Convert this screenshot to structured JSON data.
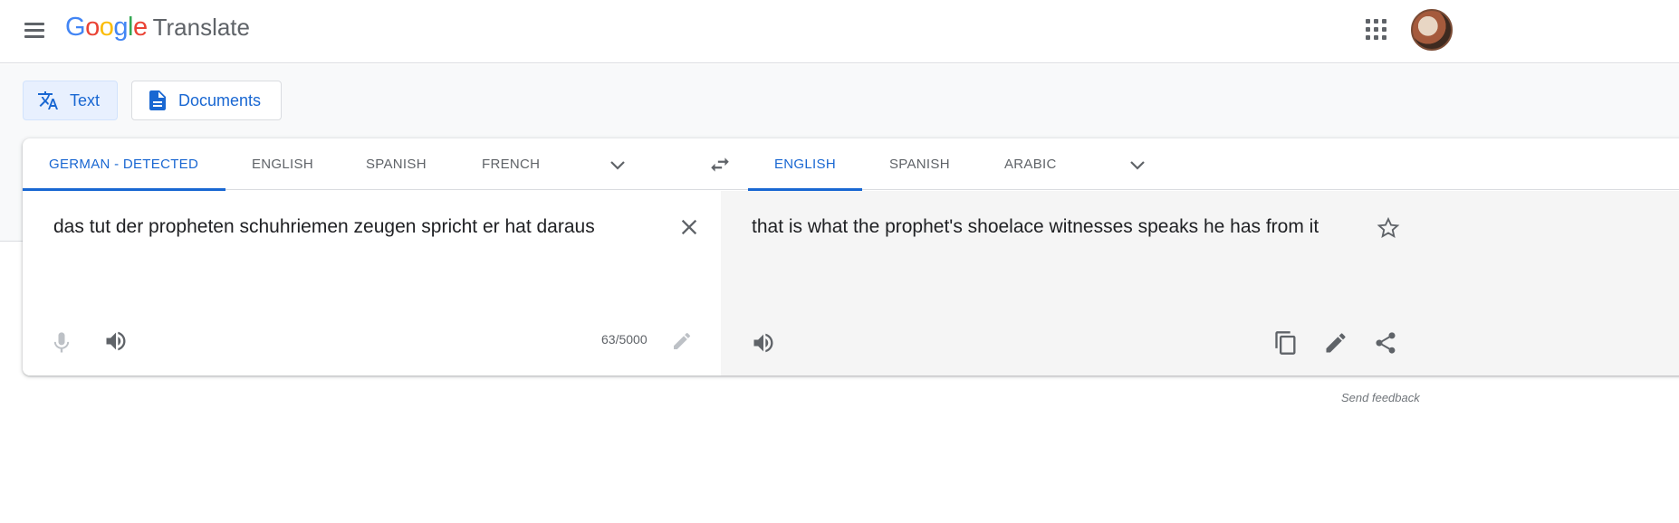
{
  "header": {
    "logo_text": "Google",
    "product_name": "Translate",
    "icons": [
      "menu-icon",
      "apps-grid-icon",
      "avatar"
    ]
  },
  "modes": {
    "text_label": "Text",
    "documents_label": "Documents"
  },
  "source_langs": {
    "tabs": [
      "GERMAN - DETECTED",
      "ENGLISH",
      "SPANISH",
      "FRENCH"
    ],
    "active_index": 0
  },
  "target_langs": {
    "tabs": [
      "ENGLISH",
      "SPANISH",
      "ARABIC"
    ],
    "active_index": 0
  },
  "source": {
    "text": "das tut der propheten schuhriemen zeugen spricht er hat daraus",
    "char_count": "63/5000"
  },
  "target": {
    "text": "that is what the prophet's shoelace witnesses speaks he has from it"
  },
  "footer": {
    "feedback": "Send feedback"
  },
  "colors": {
    "accent": "#1967d2",
    "active_bg": "#e8f0fe",
    "icon_gray": "#5f6368",
    "target_bg": "#f5f5f5"
  }
}
